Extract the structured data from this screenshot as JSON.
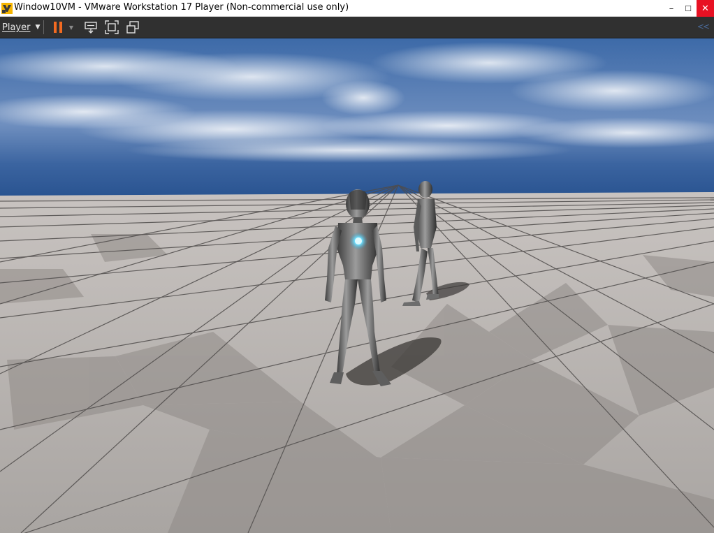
{
  "window": {
    "title": "Window10VM - VMware Workstation 17 Player (Non-commercial use only)",
    "app_icon": "vmware-player-icon",
    "controls": {
      "minimize": "–",
      "maximize": "☐",
      "close": "✕"
    }
  },
  "toolbar": {
    "player_menu_label": "Player",
    "player_menu_caret": "▼",
    "pause_dropdown_caret": "▼",
    "collapse_label": "<<",
    "icons": [
      "pause-icon",
      "send-ctrl-alt-del-icon",
      "full-screen-icon",
      "unity-icon"
    ]
  },
  "viewport": {
    "content": "unreal-engine-3d-scene",
    "colors": {
      "sky_top": "#3c66a4",
      "horizon": "#2c5590",
      "floor_light": "#b7b2ae",
      "floor_dark": "#8c8885",
      "grid_line": "#4a4746"
    },
    "characters": [
      "mannequin-front",
      "mannequin-back"
    ]
  },
  "colors": {
    "close_red": "#e81123",
    "pause_orange": "#f26a21",
    "toolbar_bg": "#303030",
    "collapse_blue": "#4a6a98"
  }
}
